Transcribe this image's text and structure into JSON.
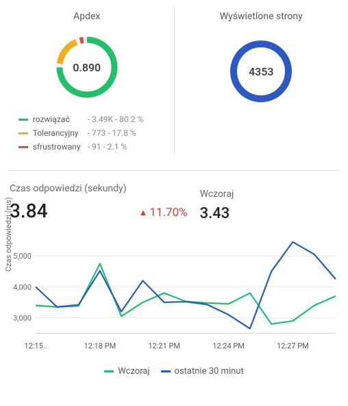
{
  "apdex": {
    "title": "Apdex",
    "score": "0.890",
    "legend": [
      {
        "label": "rozwiązać",
        "detail": "- 3.49K - 80.2 %",
        "color": "#22c06b"
      },
      {
        "label": "Tolerancyjny",
        "detail": "- 773 - 17.8 %",
        "color": "#eeb020"
      },
      {
        "label": "sfrustrowany",
        "detail": "- 91 - 2.1 %",
        "color": "#e4483b"
      }
    ]
  },
  "pageviews": {
    "title": "Wyświetlone strony",
    "value": "4353",
    "ring_color": "#2d59c3"
  },
  "response": {
    "title": "Czas odpowiedzi (sekundy)",
    "value": "3.84",
    "delta": "11.70%",
    "delta_direction": "up",
    "delta_color": "#e53935",
    "compare_title": "Wczoraj",
    "compare_value": "3.43"
  },
  "chart_data": {
    "type": "line",
    "title": "",
    "ylabel": "Czas odpowiedzi (ms)",
    "xlabel": "",
    "ylim": [
      2500,
      5600
    ],
    "yticks": [
      3000,
      4000,
      5000
    ],
    "categories": [
      "12:15..",
      "",
      "",
      "12:18 PM",
      "",
      "",
      "12:21 PM",
      "",
      "",
      "12:24 PM",
      "",
      "",
      "12:27 PM",
      "",
      ""
    ],
    "series": [
      {
        "name": "Wczoraj",
        "color": "#22c06b",
        "values": [
          3400,
          3350,
          3380,
          4750,
          3050,
          3500,
          3800,
          3530,
          3480,
          3450,
          3800,
          2800,
          2900,
          3400,
          3700
        ]
      },
      {
        "name": "ostatnie 30 minut",
        "color": "#2d59c3",
        "values": [
          4000,
          3350,
          3420,
          4520,
          3200,
          4200,
          3500,
          3520,
          3430,
          3100,
          2650,
          4500,
          5450,
          5050,
          4250
        ]
      }
    ]
  }
}
